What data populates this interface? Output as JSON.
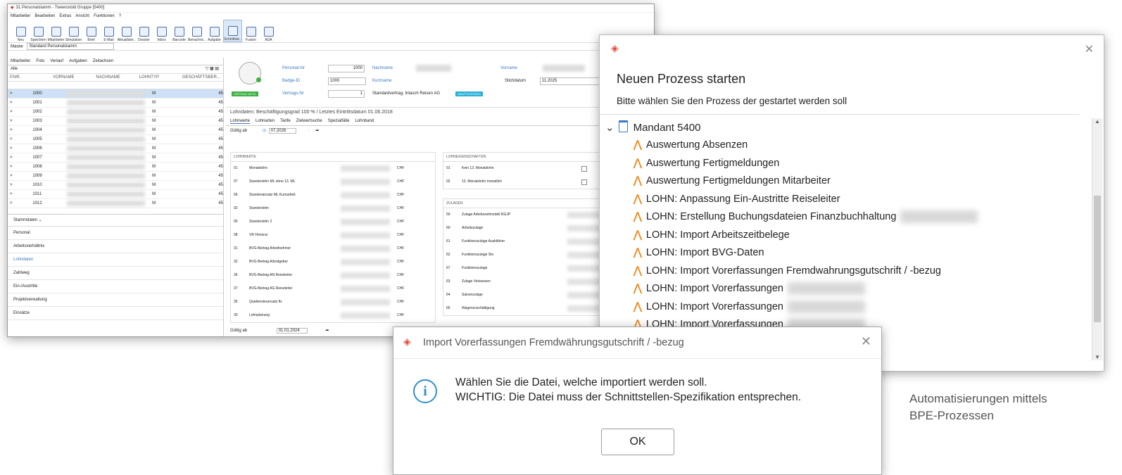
{
  "main_window": {
    "title": "31 Personalstamm - Tweenstold Gruppe [5400]",
    "menu": [
      "Mitarbeiter",
      "Bearbeiten",
      "Extras",
      "Ansicht",
      "Funktionen",
      "?"
    ],
    "ribbon": [
      "Neu",
      "Speichern",
      "Mitarbeiter",
      "Simulation",
      "Brief",
      "E-Mail",
      "Aktualisier..",
      "Dossier",
      "Inbox",
      "Barcode",
      "Benachric..",
      "Aufgabe",
      "Schnittste..",
      "Fusion",
      "ADA"
    ],
    "mask_label": "Maske",
    "mask_value": "Standard Personalstamm",
    "left_tabs": [
      "Mitarbeiter",
      "Foto",
      "Verlauf",
      "Aufgaben",
      "Zeitachsen"
    ],
    "filter_value": "Alle",
    "columns": [
      "P.NR.",
      "VORNAME",
      "NACHNAME",
      "LOHNTYP",
      "GESCHÄFTSBER..."
    ],
    "rows": [
      {
        "nr": "1000",
        "typ": "M",
        "g": "45"
      },
      {
        "nr": "1001",
        "typ": "M",
        "g": "45"
      },
      {
        "nr": "1002",
        "typ": "M",
        "g": "45"
      },
      {
        "nr": "1003",
        "typ": "M",
        "g": "45"
      },
      {
        "nr": "1004",
        "typ": "M",
        "g": "45"
      },
      {
        "nr": "1005",
        "typ": "M",
        "g": "45"
      },
      {
        "nr": "1006",
        "typ": "M",
        "g": "45"
      },
      {
        "nr": "1007",
        "typ": "M",
        "g": "45"
      },
      {
        "nr": "1008",
        "typ": "M",
        "g": "45"
      },
      {
        "nr": "1009",
        "typ": "M",
        "g": "45"
      },
      {
        "nr": "1010",
        "typ": "M",
        "g": "45"
      },
      {
        "nr": "1011",
        "typ": "M",
        "g": "45"
      },
      {
        "nr": "1012",
        "typ": "M",
        "g": "45"
      }
    ],
    "stammdaten_label": "Stammdaten",
    "nav": [
      "Personal",
      "Arbeitsverhältnis",
      "Lohndaten",
      "Zahlweg",
      "Ein-/Austritte",
      "Projektverwaltung",
      "Einsätze"
    ],
    "form": {
      "personal_nr_label": "Personal-Nr",
      "personal_nr": "1000",
      "nachname_label": "Nachname",
      "vorname_label": "Vorname",
      "badge_id_label": "Badge-ID",
      "badge_id": "1000",
      "kurzname_label": "Kurzname",
      "stichdatum_label": "Stichdatum",
      "stichdatum": "11.2025",
      "vertrags_nr_label": "Vertrags-Nr",
      "vertrags_nr": "1",
      "vertrag_text": "Standardvertrag, Intasch Reisen AG",
      "green_badge": "VERTRAG AKTIV",
      "blue_badge": "HAUPTVERTRAG"
    },
    "lohndaten_info": "Lohndaten: Beschäftigungsgrad 100 % / Letztes Eintrittsdatum 01.06.2018",
    "sub_tabs": [
      "Lohnwerte",
      "Lohnarten",
      "Tarife",
      "Zielwertsuche",
      "Spezialfälle",
      "Lohnband"
    ],
    "gueltig_ab_label": "Gültig ab",
    "gueltig_ab": "07.2026",
    "ma_label": "Ma",
    "lohnwerte_title": "LOHNWERTE",
    "lohnwerte": [
      {
        "n": "01",
        "t": "Monatslohn",
        "u": "CHF"
      },
      {
        "n": "07",
        "t": "Stundenlohn ML ohne 13. ML",
        "u": "CHF"
      },
      {
        "n": "06",
        "t": "Stundenansatz ML Kurzarbeit",
        "u": "CHF"
      },
      {
        "n": "02",
        "t": "Stundenlohn",
        "u": "CHF"
      },
      {
        "n": "05",
        "t": "Stundenlohn 2",
        "u": "CHF"
      },
      {
        "n": "08",
        "t": "VR Honorar",
        "u": "CHF"
      },
      {
        "n": "31",
        "t": "BVG-Beitrag Arbeitnehmer",
        "u": "CHF"
      },
      {
        "n": "32",
        "t": "BVG-Beitrag Arbeitgeber",
        "u": "CHF"
      },
      {
        "n": "36",
        "t": "BVG-Beitrag AN Reiseleiter",
        "u": "CHF"
      },
      {
        "n": "37",
        "t": "BVG-Beitrag AG Reiseleiter",
        "u": "CHF"
      },
      {
        "n": "35",
        "t": "Quellensteuersatz fix",
        "u": "CHF"
      },
      {
        "n": "30",
        "t": "Lohnplanung",
        "u": "CHF"
      }
    ],
    "eigenschaften_title": "LOHNEIGENSCHAFTEN",
    "eigenschaften": [
      {
        "n": "01",
        "t": "Kein 13. Monatslohn"
      },
      {
        "n": "02",
        "t": "13. Monatslohn monatlich"
      }
    ],
    "zulagen_title": "ZULAGEN",
    "zulagen": [
      {
        "n": "59",
        "t": "Zulage Arbeitszeitmodell RGJP"
      },
      {
        "n": "60",
        "t": "Arbeitszulage"
      },
      {
        "n": "61",
        "t": "Funktionszulage Ausbildner"
      },
      {
        "n": "62",
        "t": "Funktionszulage Stv."
      },
      {
        "n": "67",
        "t": "Funktionszulage"
      },
      {
        "n": "63",
        "t": "Zulage Velowesen"
      },
      {
        "n": "64",
        "t": "Saisonzulage"
      },
      {
        "n": "66",
        "t": "Wagenzuschädigung"
      }
    ],
    "bottom_gueltig": "01.01.2024"
  },
  "process_dialog": {
    "title": "Neuen Prozess starten",
    "subtitle": "Bitte wählen Sie den Prozess der gestartet werden soll",
    "root": "Mandant 5400",
    "items": [
      "Auswertung Absenzen",
      "Auswertung Fertigmeldungen",
      "Auswertung Fertigmeldungen Mitarbeiter",
      "LOHN: Anpassung Ein-Austritte Reiseleiter",
      "LOHN: Erstellung Buchungsdateien Finanzbuchhaltung",
      "LOHN: Import Arbeitszeitbelege",
      "LOHN: Import BVG-Daten",
      "LOHN: Import Vorerfassungen Fremdwahrungsgutschrift / -bezug",
      "LOHN: Import Vorerfassungen",
      "LOHN: Import Vorerfassungen",
      "LOHN: Import Vorerfassungen"
    ]
  },
  "import_dialog": {
    "title": "Import Vorerfassungen Fremdwährungsgutschrift / -bezug",
    "message_line1": "Wählen Sie die Datei, welche importiert werden soll.",
    "message_line2": "WICHTIG: Die Datei muss der Schnittstellen-Spezifikation entsprechen.",
    "ok_label": "OK"
  },
  "caption_line1": "Automatisierungen mittels",
  "caption_line2": "BPE-Prozessen"
}
